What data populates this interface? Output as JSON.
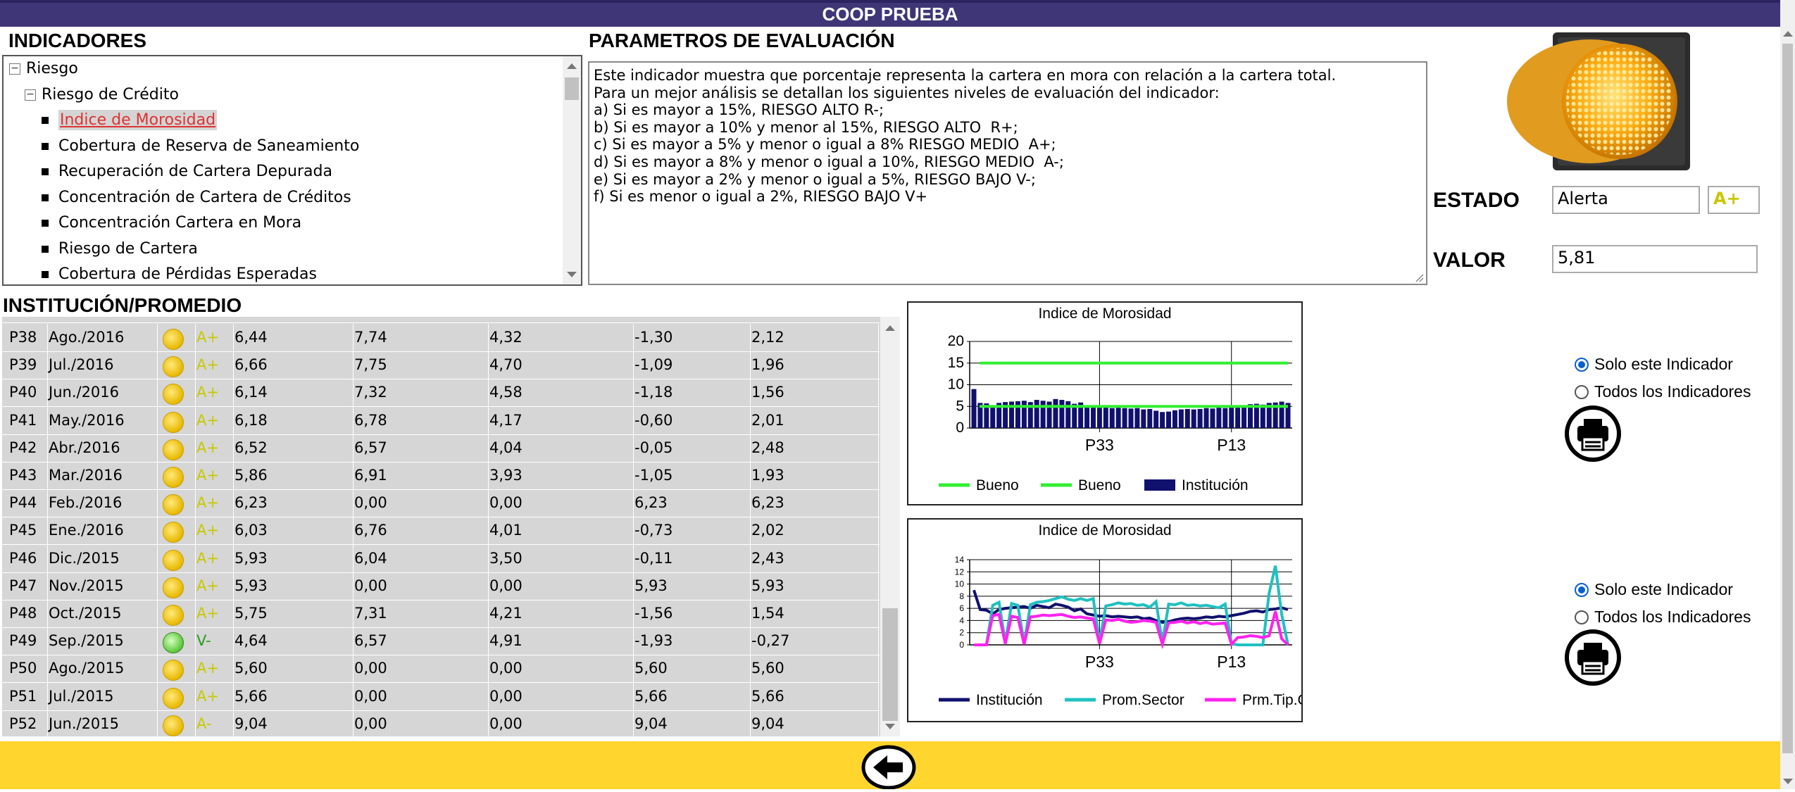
{
  "app": {
    "title": "COOP PRUEBA"
  },
  "indicadores": {
    "title": "INDICADORES",
    "tree": [
      {
        "label": "Riesgo",
        "level": 0,
        "expander": "⊟"
      },
      {
        "label": "Riesgo de Crédito",
        "level": 1,
        "expander": "⊟"
      },
      {
        "label": "Indice de Morosidad",
        "level": 2,
        "selected": true
      },
      {
        "label": "Cobertura de Reserva de Saneamiento",
        "level": 2
      },
      {
        "label": "Recuperación de Cartera Depurada",
        "level": 2
      },
      {
        "label": "Concentración de Cartera de Créditos",
        "level": 2
      },
      {
        "label": "Concentración Cartera en Mora",
        "level": 2
      },
      {
        "label": "Riesgo de Cartera",
        "level": 2
      },
      {
        "label": "Cobertura de Pérdidas Esperadas",
        "level": 2
      }
    ]
  },
  "parametros": {
    "title": "PARAMETROS DE EVALUACIÓN",
    "lines": [
      "Este indicador muestra que porcentaje representa la cartera en mora con relación a la cartera total.",
      "Para un mejor análisis se detallan los siguientes niveles de evaluación del indicador:",
      "",
      "a) Si es mayor a 15%, RIESGO ALTO R-;",
      "b) Si es mayor a 10% y menor al 15%, RIESGO ALTO  R+;",
      "c) Si es mayor a 5% y menor o igual a 8% RIESGO MEDIO  A+;",
      "d) Si es mayor a 8% y menor o igual a 10%, RIESGO MEDIO  A-;",
      "e) Si es mayor a 2% y menor o igual a 5%, RIESGO BAJO V-;",
      "f) Si es menor o igual a 2%, RIESGO BAJO V+"
    ]
  },
  "estado": {
    "label": "ESTADO",
    "value": "Alerta",
    "grade": "A+"
  },
  "valor": {
    "label": "VALOR",
    "value": "5,81"
  },
  "institucion": {
    "title": "INSTITUCIÓN/PROMEDIO",
    "rows": [
      {
        "p": "P38",
        "fecha": "Ago./2016",
        "icon": "yellow",
        "grade": "A+",
        "v1": "6,44",
        "v2": "7,74",
        "v3": "4,32",
        "v4": "-1,30",
        "v5": "2,12"
      },
      {
        "p": "P39",
        "fecha": "Jul./2016",
        "icon": "yellow",
        "grade": "A+",
        "v1": "6,66",
        "v2": "7,75",
        "v3": "4,70",
        "v4": "-1,09",
        "v5": "1,96"
      },
      {
        "p": "P40",
        "fecha": "Jun./2016",
        "icon": "yellow",
        "grade": "A+",
        "v1": "6,14",
        "v2": "7,32",
        "v3": "4,58",
        "v4": "-1,18",
        "v5": "1,56"
      },
      {
        "p": "P41",
        "fecha": "May./2016",
        "icon": "yellow",
        "grade": "A+",
        "v1": "6,18",
        "v2": "6,78",
        "v3": "4,17",
        "v4": "-0,60",
        "v5": "2,01"
      },
      {
        "p": "P42",
        "fecha": "Abr./2016",
        "icon": "yellow",
        "grade": "A+",
        "v1": "6,52",
        "v2": "6,57",
        "v3": "4,04",
        "v4": "-0,05",
        "v5": "2,48"
      },
      {
        "p": "P43",
        "fecha": "Mar./2016",
        "icon": "yellow",
        "grade": "A+",
        "v1": "5,86",
        "v2": "6,91",
        "v3": "3,93",
        "v4": "-1,05",
        "v5": "1,93"
      },
      {
        "p": "P44",
        "fecha": "Feb./2016",
        "icon": "yellow",
        "grade": "A+",
        "v1": "6,23",
        "v2": "0,00",
        "v3": "0,00",
        "v4": "6,23",
        "v5": "6,23"
      },
      {
        "p": "P45",
        "fecha": "Ene./2016",
        "icon": "yellow",
        "grade": "A+",
        "v1": "6,03",
        "v2": "6,76",
        "v3": "4,01",
        "v4": "-0,73",
        "v5": "2,02"
      },
      {
        "p": "P46",
        "fecha": "Dic./2015",
        "icon": "yellow",
        "grade": "A+",
        "v1": "5,93",
        "v2": "6,04",
        "v3": "3,50",
        "v4": "-0,11",
        "v5": "2,43"
      },
      {
        "p": "P47",
        "fecha": "Nov./2015",
        "icon": "yellow",
        "grade": "A+",
        "v1": "5,93",
        "v2": "0,00",
        "v3": "0,00",
        "v4": "5,93",
        "v5": "5,93"
      },
      {
        "p": "P48",
        "fecha": "Oct./2015",
        "icon": "yellow",
        "grade": "A+",
        "v1": "5,75",
        "v2": "7,31",
        "v3": "4,21",
        "v4": "-1,56",
        "v5": "1,54"
      },
      {
        "p": "P49",
        "fecha": "Sep./2015",
        "icon": "green",
        "grade": "V-",
        "v1": "4,64",
        "v2": "6,57",
        "v3": "4,91",
        "v4": "-1,93",
        "v5": "-0,27"
      },
      {
        "p": "P50",
        "fecha": "Ago./2015",
        "icon": "yellow",
        "grade": "A+",
        "v1": "5,60",
        "v2": "0,00",
        "v3": "0,00",
        "v4": "5,60",
        "v5": "5,60"
      },
      {
        "p": "P51",
        "fecha": "Jul./2015",
        "icon": "yellow",
        "grade": "A+",
        "v1": "5,66",
        "v2": "0,00",
        "v3": "0,00",
        "v4": "5,66",
        "v5": "5,66"
      },
      {
        "p": "P52",
        "fecha": "Jun./2015",
        "icon": "yellow",
        "grade": "A-",
        "v1": "9,04",
        "v2": "0,00",
        "v3": "0,00",
        "v4": "9,04",
        "v5": "9,04"
      }
    ]
  },
  "options": {
    "solo": "Solo este Indicador",
    "todos": "Todos los Indicadores"
  },
  "colors": {
    "institucion_bar": "#10106e",
    "bueno": "#33ee33",
    "prom_sector": "#20c0c0",
    "prm_tip": "#ff22ee",
    "institucion_line": "#10106e",
    "footer": "#ffd52e",
    "titlebar": "#3f3678"
  },
  "chart_data": [
    {
      "type": "bar",
      "title": "Indice de Morosidad",
      "yticks": [
        0,
        5,
        10,
        15,
        20
      ],
      "ylim": [
        0,
        20
      ],
      "xtick_labels": [
        "P33",
        "P13"
      ],
      "legend": [
        "Bueno",
        "Bueno",
        "Institución"
      ],
      "series": [
        {
          "name": "Institución",
          "kind": "bar",
          "values": [
            9.0,
            5.8,
            5.7,
            5.1,
            5.8,
            6.0,
            6.1,
            6.2,
            6.3,
            6.0,
            6.5,
            6.3,
            6.1,
            6.7,
            6.5,
            6.2,
            5.6,
            5.9,
            5.1,
            4.9,
            4.7,
            4.8,
            4.6,
            4.7,
            4.6,
            4.5,
            4.6,
            4.3,
            4.4,
            4.0,
            3.7,
            3.8,
            4.1,
            4.3,
            4.4,
            4.3,
            4.4,
            4.6,
            4.5,
            4.7,
            4.6,
            4.8,
            5.0,
            5.2,
            5.5,
            5.6,
            5.4,
            5.8,
            5.9,
            6.1,
            5.8
          ]
        },
        {
          "name": "Bueno",
          "kind": "line",
          "values": [
            15,
            15
          ]
        },
        {
          "name": "Bueno",
          "kind": "line",
          "values": [
            5,
            5
          ]
        }
      ]
    },
    {
      "type": "line",
      "title": "Indice de Morosidad",
      "yticks": [
        0,
        2,
        4,
        6,
        8,
        10,
        12,
        14
      ],
      "ylim": [
        0,
        14
      ],
      "xtick_labels": [
        "P33",
        "P13"
      ],
      "legend": [
        "Institución",
        "Prom.Sector",
        "Prm.Tip.Coop"
      ],
      "series": [
        {
          "name": "Institución",
          "values": [
            9.0,
            5.8,
            5.7,
            5.1,
            5.8,
            6.0,
            6.1,
            6.2,
            6.3,
            6.0,
            6.5,
            6.3,
            6.1,
            6.7,
            6.5,
            6.2,
            5.6,
            5.9,
            5.1,
            4.9,
            4.7,
            4.8,
            4.6,
            4.7,
            4.6,
            4.5,
            4.6,
            4.3,
            4.4,
            4.0,
            3.7,
            3.8,
            4.1,
            4.3,
            4.4,
            4.3,
            4.4,
            4.6,
            4.5,
            4.7,
            4.6,
            4.8,
            5.0,
            5.2,
            5.5,
            5.6,
            5.4,
            5.8,
            5.9,
            6.1,
            5.8
          ]
        },
        {
          "name": "Prom.Sector",
          "values": [
            0,
            0,
            0,
            6.5,
            7.0,
            0.3,
            6.8,
            6.5,
            0.2,
            6.6,
            7.0,
            7.1,
            7.3,
            7.6,
            7.9,
            7.5,
            7.3,
            7.6,
            7.3,
            7.6,
            0.4,
            6.4,
            6.6,
            6.9,
            6.7,
            6.8,
            6.5,
            6.6,
            6.2,
            7.1,
            0.3,
            6.7,
            6.6,
            6.9,
            6.5,
            6.6,
            6.4,
            6.5,
            6.3,
            6.1,
            6.7,
            0.2,
            0.0,
            0.0,
            0.0,
            0.0,
            0.0,
            8.5,
            13.0,
            5.0,
            0.0
          ]
        },
        {
          "name": "Prm.Tip.Coop",
          "values": [
            0,
            0,
            0,
            4.8,
            5.0,
            0.2,
            4.7,
            4.5,
            0.1,
            4.6,
            4.7,
            4.9,
            4.8,
            4.9,
            5.0,
            4.7,
            4.5,
            4.6,
            4.4,
            4.3,
            0.2,
            4.1,
            4.0,
            4.2,
            3.9,
            3.7,
            3.8,
            4.0,
            3.9,
            3.7,
            0.1,
            3.6,
            3.7,
            3.9,
            3.6,
            3.8,
            3.5,
            3.7,
            3.4,
            3.5,
            3.6,
            0.1,
            1.2,
            1.3,
            1.5,
            1.4,
            1.2,
            1.5,
            5.5,
            1.0,
            0.0
          ]
        }
      ]
    }
  ]
}
